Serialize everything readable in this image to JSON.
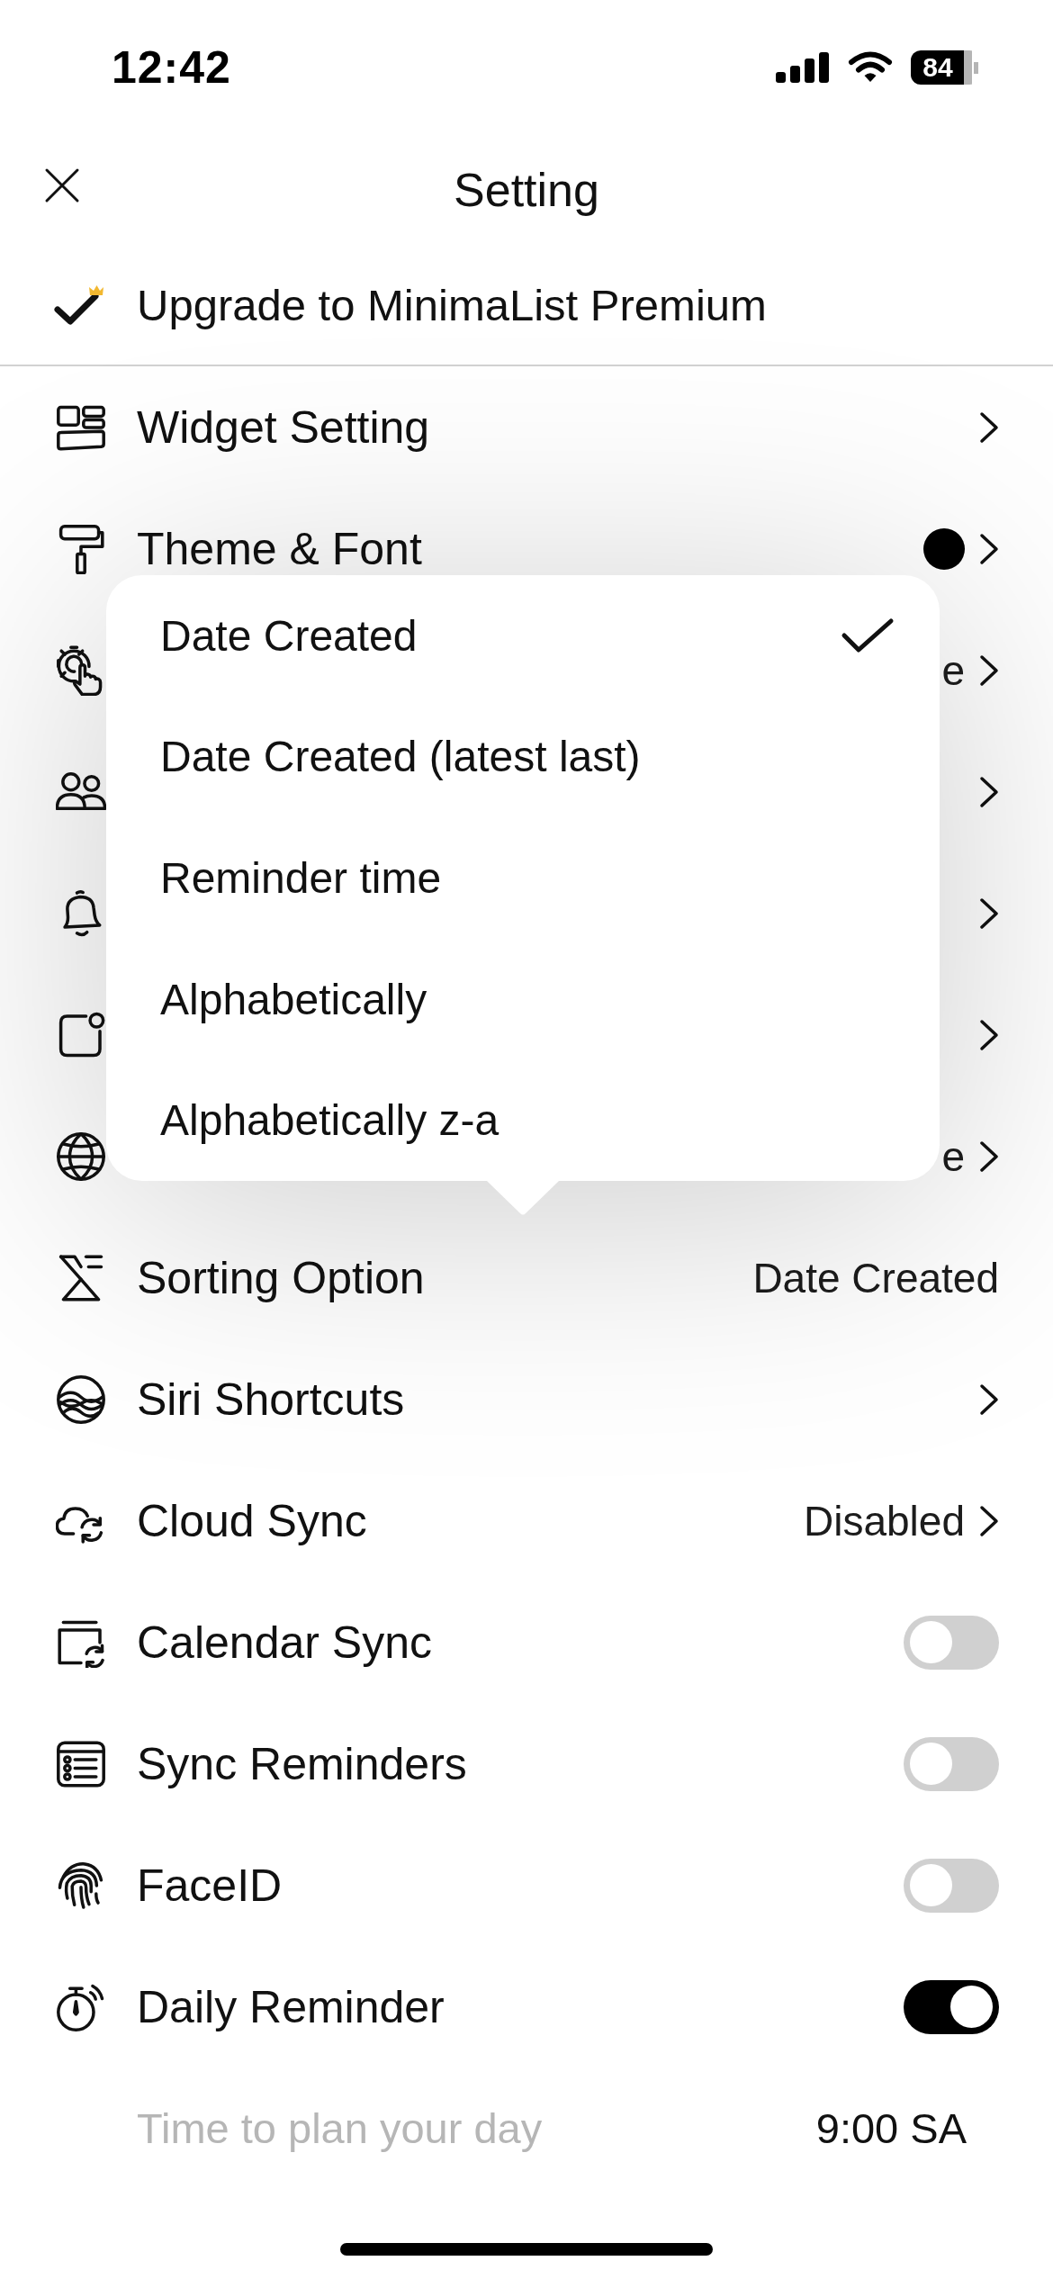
{
  "status_bar": {
    "time": "12:42",
    "battery": "84"
  },
  "header": {
    "title": "Setting"
  },
  "upgrade": {
    "label": "Upgrade to MinimaList Premium"
  },
  "rows": [
    {
      "kind": "link",
      "label": "Widget Setting"
    },
    {
      "kind": "swatch",
      "label": "Theme & Font",
      "color": "#000000"
    },
    {
      "kind": "link",
      "value": "e"
    },
    {
      "kind": "link"
    },
    {
      "kind": "link"
    },
    {
      "kind": "link"
    },
    {
      "kind": "link",
      "value": "e"
    },
    {
      "kind": "value",
      "label": "Sorting Option",
      "value": "Date Created"
    },
    {
      "kind": "link",
      "label": "Siri Shortcuts"
    },
    {
      "kind": "link",
      "label": "Cloud Sync",
      "value": "Disabled"
    },
    {
      "kind": "toggle",
      "label": "Calendar Sync",
      "on": false
    },
    {
      "kind": "toggle",
      "label": "Sync Reminders",
      "on": false
    },
    {
      "kind": "toggle",
      "label": "FaceID",
      "on": false
    },
    {
      "kind": "toggle",
      "label": "Daily Reminder",
      "on": true
    },
    {
      "kind": "detail",
      "label": "Time to plan your day",
      "value": "9:00 SA"
    }
  ],
  "sort_menu": {
    "options": [
      {
        "label": "Date Created",
        "selected": true
      },
      {
        "label": "Date Created (latest last)",
        "selected": false
      },
      {
        "label": "Reminder time",
        "selected": false
      },
      {
        "label": "Alphabetically",
        "selected": false
      },
      {
        "label": "Alphabetically z-a",
        "selected": false
      }
    ]
  }
}
